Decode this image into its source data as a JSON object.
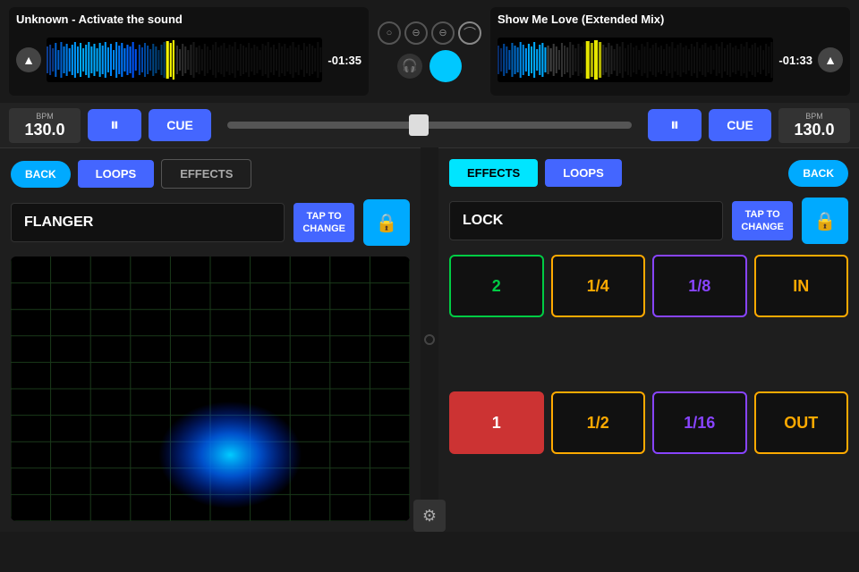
{
  "left_deck": {
    "title": "Unknown - Activate the sound",
    "time": "-01:35",
    "bpm_label": "BPM",
    "bpm_value": "130.0"
  },
  "right_deck": {
    "title": "Show Me Love (Extended Mix)",
    "time": "-01:33",
    "bpm_label": "BPM",
    "bpm_value": "130.0"
  },
  "controls": {
    "play_label": "⏸",
    "cue_label": "CUE",
    "back_label": "BACK"
  },
  "left_panel": {
    "loops_tab": "LOOPS",
    "effects_tab": "EFFECTS",
    "effect_name": "FLANGER",
    "tap_to_change": "TAP TO\nCHANGE"
  },
  "right_panel": {
    "effects_tab": "EFFECTS",
    "loops_tab": "LOOPS",
    "lock_name": "LOCK",
    "tap_to_change": "TAP TO\nCHANGE",
    "loop_buttons": [
      {
        "label": "2",
        "style": "loop-green"
      },
      {
        "label": "1/4",
        "style": "loop-yellow"
      },
      {
        "label": "1/8",
        "style": "loop-purple"
      },
      {
        "label": "IN",
        "style": "loop-gold"
      },
      {
        "label": "1",
        "style": "loop-red"
      },
      {
        "label": "1/2",
        "style": "loop-yellow2"
      },
      {
        "label": "1/16",
        "style": "loop-purple2"
      },
      {
        "label": "OUT",
        "style": "loop-gold2"
      }
    ]
  },
  "center": {
    "transport_icons": [
      "○",
      "⊖",
      "⊖",
      "◡"
    ],
    "master_label": ""
  },
  "settings_icon": "⚙"
}
